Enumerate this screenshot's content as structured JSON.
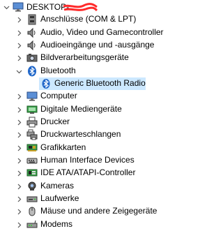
{
  "root": {
    "label": "DESKTOP-",
    "icon": "computer-icon"
  },
  "categories": [
    {
      "label": "Anschlüsse (COM & LPT)",
      "icon": "port-icon",
      "expanded": false
    },
    {
      "label": "Audio, Video und Gamecontroller",
      "icon": "speaker-icon",
      "expanded": false
    },
    {
      "label": "Audioeingänge und -ausgänge",
      "icon": "speaker-icon",
      "expanded": false
    },
    {
      "label": "Bildverarbeitungsgeräte",
      "icon": "camera-device-icon",
      "expanded": false
    },
    {
      "label": "Bluetooth",
      "icon": "bluetooth-icon",
      "expanded": true,
      "children": [
        {
          "label": "Generic Bluetooth Radio",
          "icon": "bluetooth-icon",
          "selected": true
        }
      ]
    },
    {
      "label": "Computer",
      "icon": "monitor-icon",
      "expanded": false
    },
    {
      "label": "Digitale Mediengeräte",
      "icon": "media-device-icon",
      "expanded": false
    },
    {
      "label": "Drucker",
      "icon": "printer-icon",
      "expanded": false
    },
    {
      "label": "Druckwarteschlangen",
      "icon": "print-queue-icon",
      "expanded": false
    },
    {
      "label": "Grafikkarten",
      "icon": "display-adapter-icon",
      "expanded": false
    },
    {
      "label": "Human Interface Devices",
      "icon": "hid-icon",
      "expanded": false
    },
    {
      "label": "IDE ATA/ATAPI-Controller",
      "icon": "ide-controller-icon",
      "expanded": false
    },
    {
      "label": "Kameras",
      "icon": "webcam-icon",
      "expanded": false
    },
    {
      "label": "Laufwerke",
      "icon": "disk-drive-icon",
      "expanded": false
    },
    {
      "label": "Mäuse und andere Zeigegeräte",
      "icon": "mouse-icon",
      "expanded": false
    },
    {
      "label": "Modems",
      "icon": "modem-icon",
      "expanded": false
    }
  ],
  "colors": {
    "selection": "#cce8ff",
    "redaction": "#ff2a2a",
    "bluetooth": "#1f66c9",
    "toggle": "#555555"
  }
}
